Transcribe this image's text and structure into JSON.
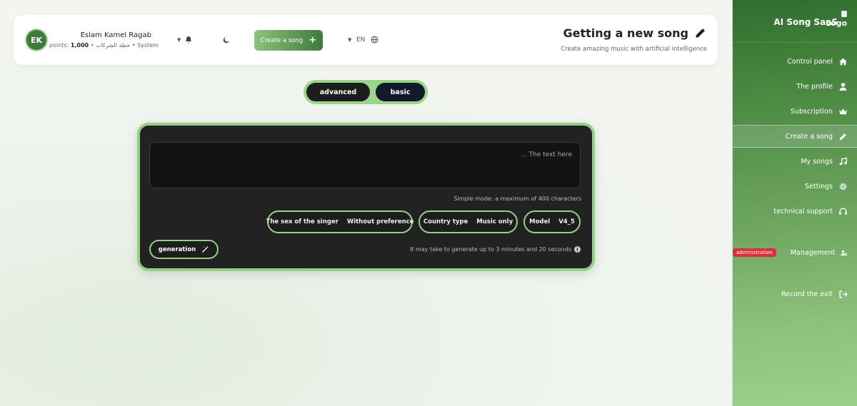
{
  "user": {
    "initials": "EK",
    "name": "Eslam Kamel Ragab",
    "meta_prefix": "points:",
    "points": "1,000",
    "meta_suffix": "• خطة الشركات • System"
  },
  "header": {
    "create_label": "Create a song",
    "lang": "EN",
    "title": "Getting a new song",
    "subtitle": "Create amazing music with artificial intelligence"
  },
  "modes": {
    "advanced": "advanced",
    "basic": "basic"
  },
  "form": {
    "placeholder": "... The text here",
    "hint": "Simple mode: a maximum of 400 characters",
    "sex_label": "The sex of the singer",
    "sex_value": "Without preference",
    "country_label": "Country type",
    "country_value": "Music only",
    "model_label": "Model",
    "model_value": "V4_5",
    "generate_label": "generation",
    "note": "It may take to generate up to 3 minutes and 20 seconds"
  },
  "sidebar": {
    "brand": "AI Song SaaS",
    "logo_alt": "Logo",
    "items": [
      {
        "label": "Control panel",
        "icon": "home-icon"
      },
      {
        "label": "The profile",
        "icon": "user-icon"
      },
      {
        "label": "Subscription",
        "icon": "crown-icon"
      },
      {
        "label": "Create a song",
        "icon": "pencil-icon"
      },
      {
        "label": "My songs",
        "icon": "music-icon"
      },
      {
        "label": "Settings",
        "icon": "gear-icon"
      },
      {
        "label": "technical support",
        "icon": "headset-icon"
      },
      {
        "label": "Management",
        "icon": "user-cog-icon",
        "badge": "administration"
      },
      {
        "label": "Record the exit",
        "icon": "logout-icon"
      }
    ]
  },
  "colors": {
    "accent": "#95d085",
    "brand_dark": "#2f6e2d",
    "danger": "#d9303c"
  }
}
